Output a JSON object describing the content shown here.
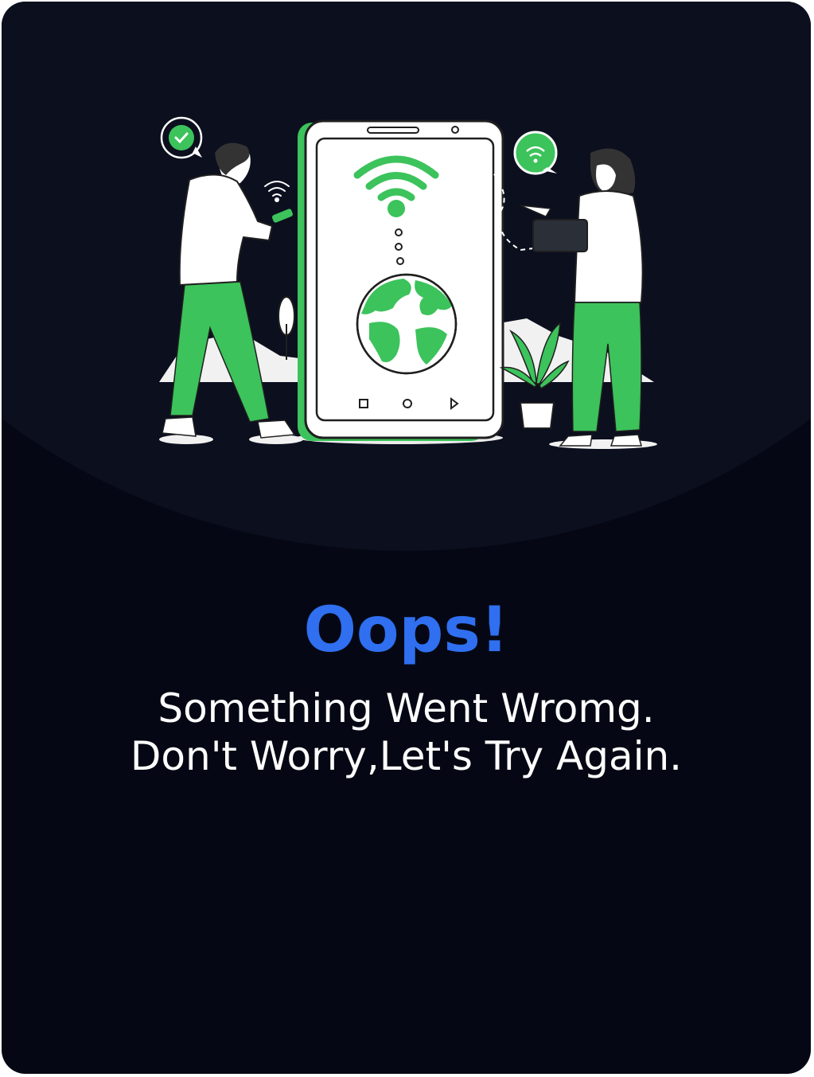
{
  "error": {
    "title": "Oops!",
    "message_line1": "Something Went Wromg.",
    "message_line2": "Don't Worry,Let's Try Again."
  },
  "illustration": {
    "icons": [
      "check-icon",
      "wifi-icon",
      "globe-icon",
      "phone-icon",
      "plant-icon"
    ]
  },
  "colors": {
    "background": "#050814",
    "arc": "#0b0f1e",
    "accent_blue": "#2f6ff0",
    "accent_green": "#3cc35b"
  }
}
